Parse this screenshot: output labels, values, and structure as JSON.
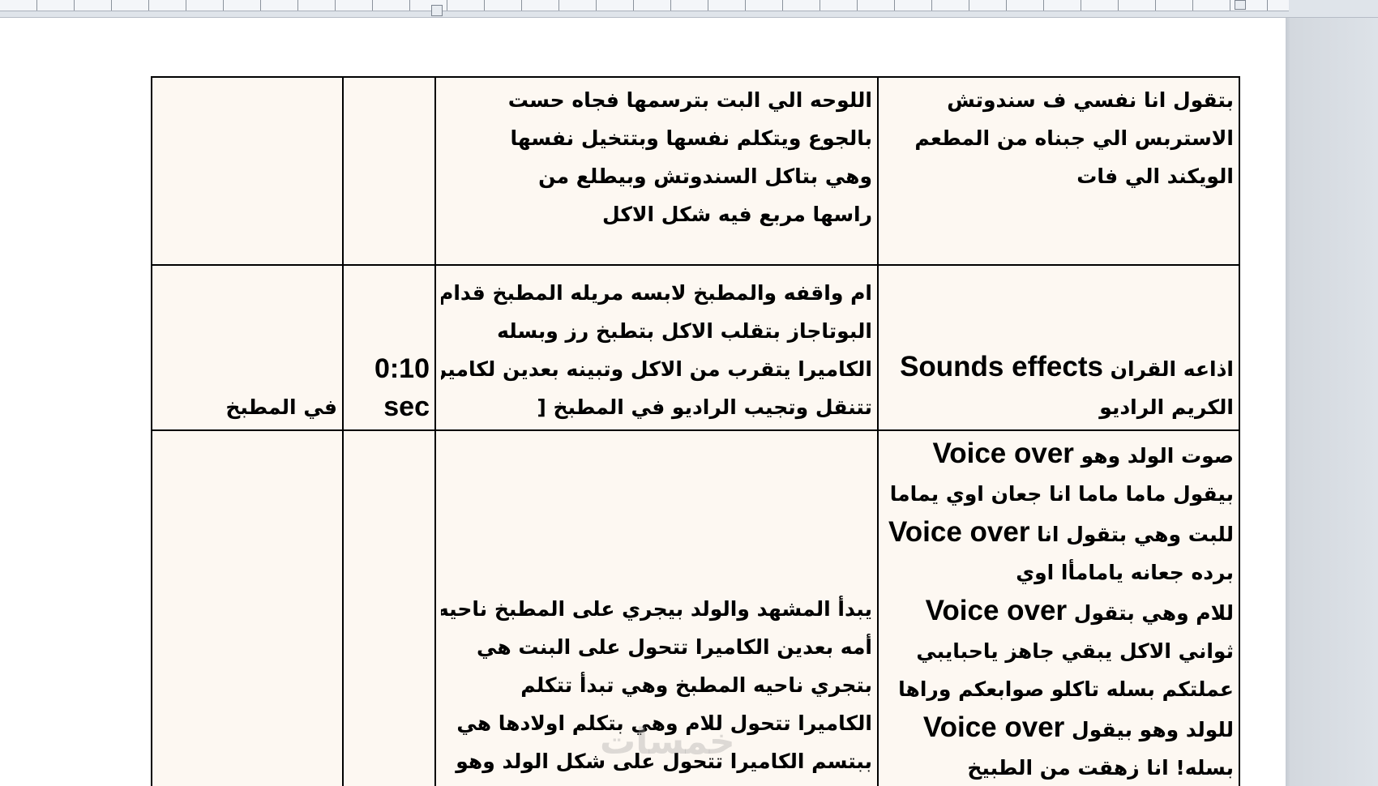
{
  "rows": [
    {
      "audio_lines": [
        "بتقول انا نفسي ف سندوتش",
        "الاستربس الي جبناه من المطعم",
        "الويكند الي فات"
      ],
      "visual_lines": [
        "اللوحه الي البت بترسمها فجاه حست",
        "بالجوع ويتكلم نفسها وبتتخيل نفسها",
        "وهي بتاكل السندوتش وبيطلع من",
        "راسها مربع فيه شكل الاكل"
      ],
      "time": "",
      "place": ""
    },
    {
      "audio_lines": [
        {
          "ar": "اذاعه القران",
          "en": "Sounds effects"
        },
        {
          "ar": "الكريم الراديو",
          "en": ""
        }
      ],
      "visual_lines": [
        "ام واقفه والمطبخ لابسه مريله المطبخ قدام",
        "البوتاجاز بتقلب الاكل بتطبخ رز وبسله",
        "الكاميرا يتقرب من الاكل وتبينه بعدين لكاميرا",
        "تتنقل وتجيب الراديو في المطبخ ["
      ],
      "time_lines": [
        "0:10",
        "sec"
      ],
      "place": "في المطبخ"
    },
    {
      "audio_lines": [
        {
          "ar": "صوت الولد وهو",
          "en": "Voice over"
        },
        {
          "ar": "بيقول ماما ماما انا جعان اوي يماما",
          "en": ""
        },
        {
          "ar": "للبت وهي بتقول انا",
          "en": "Voice over"
        },
        {
          "ar": "برده جعانه يامامأا اوي",
          "en": ""
        },
        {
          "ar": "للام وهي بتقول",
          "en": "Voice over"
        },
        {
          "ar": "ثواني الاكل يبقي جاهز ياحبايبي",
          "en": ""
        },
        {
          "ar": "عملتكم بسله تاكلو صوابعكم وراها",
          "en": ""
        },
        {
          "ar": "للولد وهو بيقول",
          "en": "Voice over"
        },
        {
          "ar": "بسله! انا زهقت من الطبيخ",
          "en": ""
        }
      ],
      "visual_lines": [
        "يبدأ المشهد والولد بيجري على المطبخ ناحيه",
        "أمه بعدين الكاميرا تتحول على البنت هي",
        "بتجري ناحيه المطبخ وهي تبدأ تتكلم",
        "الكاميرا تتحول للام وهي بتكلم اولادها هي",
        "ببتسم الكاميرا تتحول على شكل الولد وهو"
      ],
      "time": "",
      "place": ""
    }
  ],
  "watermark": "خمسات"
}
